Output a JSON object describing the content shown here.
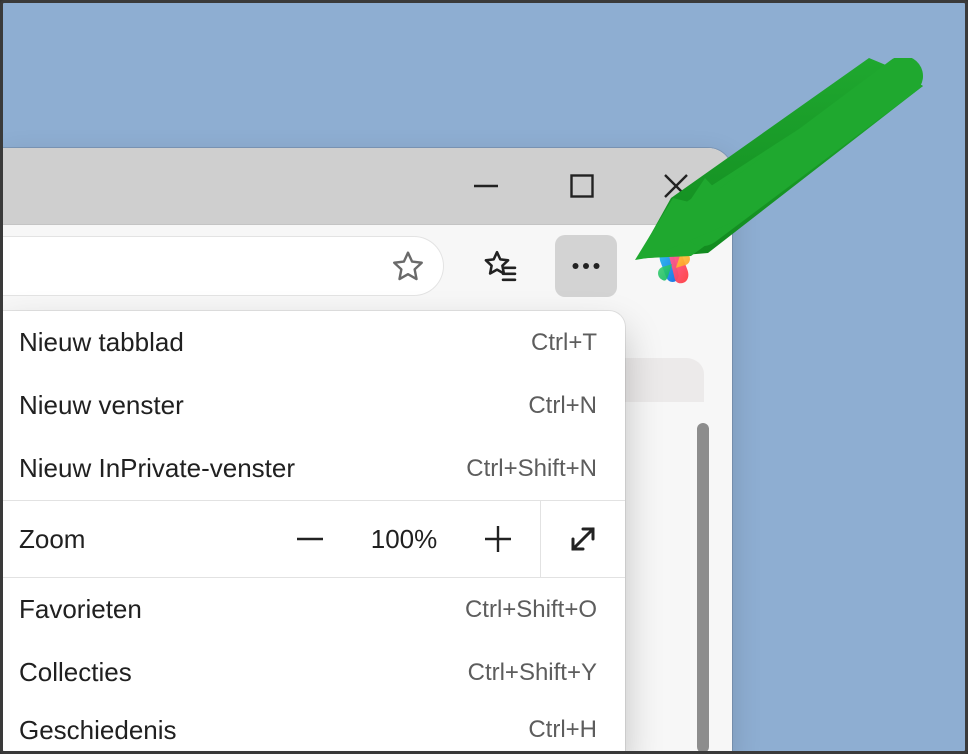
{
  "window": {
    "min": "Minimize",
    "max": "Maximize",
    "close": "Close"
  },
  "toolbar": {
    "star": "Add to favorites",
    "favs": "Favorites list",
    "more": "Settings and more",
    "copilot": "Copilot"
  },
  "menu": {
    "items": [
      {
        "label": "Nieuw tabblad",
        "shortcut": "Ctrl+T"
      },
      {
        "label": "Nieuw venster",
        "shortcut": "Ctrl+N"
      },
      {
        "label": "Nieuw InPrivate-venster",
        "shortcut": "Ctrl+Shift+N"
      }
    ],
    "zoom": {
      "label": "Zoom",
      "value": "100%",
      "out": "Zoom out",
      "in": "Zoom in",
      "fullscreen": "Full screen"
    },
    "items2": [
      {
        "label": "Favorieten",
        "shortcut": "Ctrl+Shift+O"
      },
      {
        "label": "Collecties",
        "shortcut": "Ctrl+Shift+Y"
      },
      {
        "label": "Geschiedenis",
        "shortcut": "Ctrl+H"
      }
    ]
  }
}
